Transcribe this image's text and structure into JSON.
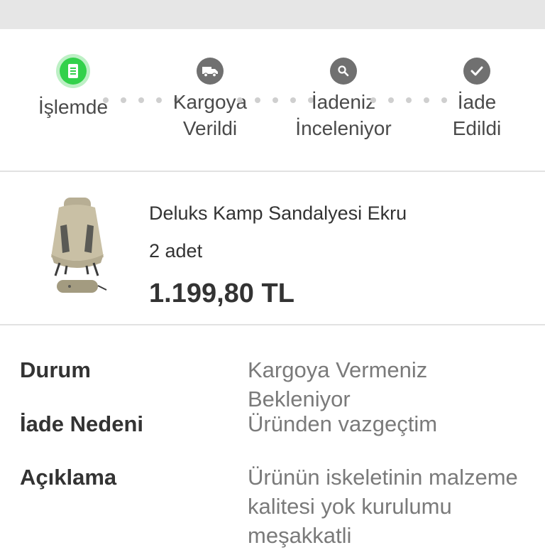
{
  "stepper": {
    "steps": [
      {
        "label_line1": "İşlemde",
        "label_line2": ""
      },
      {
        "label_line1": "Kargoya",
        "label_line2": "Verildi"
      },
      {
        "label_line1": "İadeniz",
        "label_line2": "İnceleniyor"
      },
      {
        "label_line1": "İade",
        "label_line2": "Edildi"
      }
    ],
    "active_step": 1,
    "colors": {
      "active": "#33d14b",
      "inactive": "#707070",
      "dots": "#cfcfcf"
    }
  },
  "product": {
    "name": "Deluks Kamp Sandalyesi Ekru",
    "quantity": "2 adet",
    "price": "1.199,80 TL"
  },
  "details": {
    "status_label": "Durum",
    "status_value": "Kargoya Vermeniz Bekleniyor",
    "reason_label": "İade Nedeni",
    "reason_value": "Üründen vazgeçtim",
    "description_label": "Açıklama",
    "description_value": "Ürünün iskeletinin malzeme kalitesi yok kurulumu meşakkatli"
  }
}
